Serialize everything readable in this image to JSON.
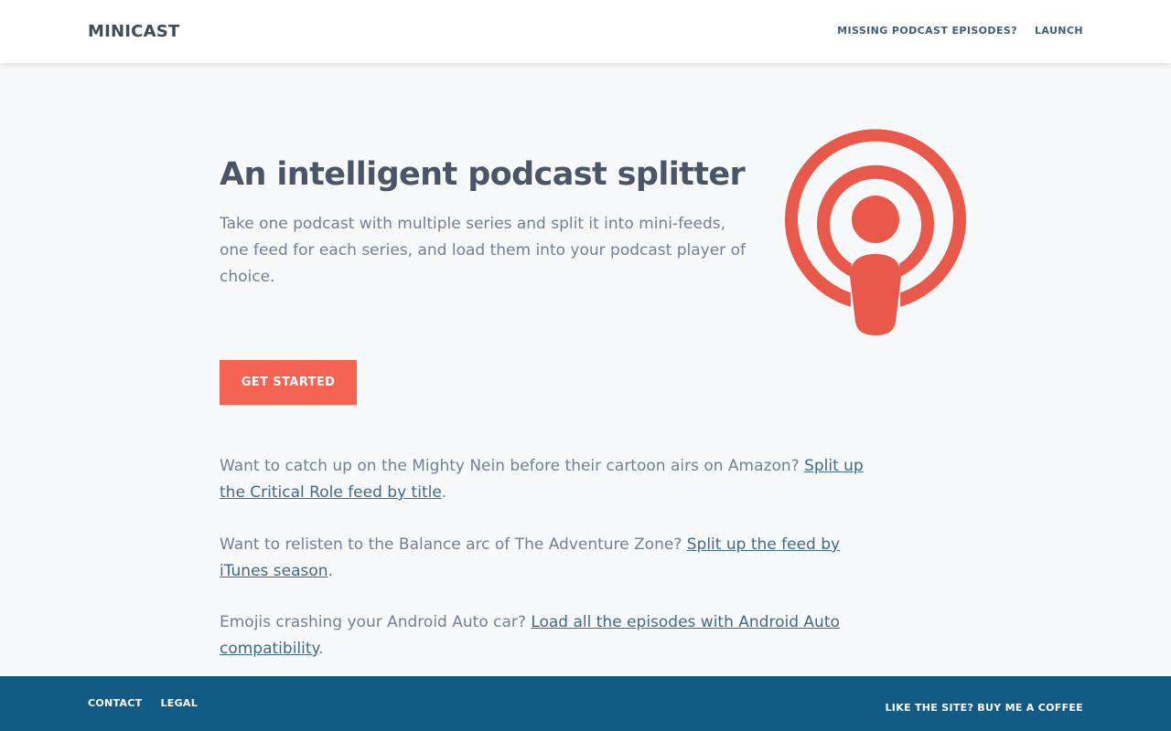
{
  "header": {
    "brand": "MINICAST",
    "nav": [
      {
        "label": "MISSING PODCAST EPISODES?"
      },
      {
        "label": "LAUNCH"
      }
    ]
  },
  "hero": {
    "title": "An intelligent podcast splitter",
    "subtitle": "Take one podcast with multiple series and split it into mini-feeds, one feed for each series, and load them into your podcast player of choice.",
    "cta_label": "GET STARTED",
    "logo_icon": "podcast-icon"
  },
  "examples": [
    {
      "text": "Want to catch up on the Mighty Nein before their cartoon airs on Amazon? ",
      "link": "Split up the Critical Role feed by title",
      "after": "."
    },
    {
      "text": "Want to relisten to the Balance arc of The Adventure Zone? ",
      "link": "Split up the feed by iTunes season",
      "after": "."
    },
    {
      "text": "Emojis crashing your Android Auto car? ",
      "link": "Load all the episodes with Android Auto compatibility",
      "after": "."
    }
  ],
  "footer": {
    "left": [
      {
        "label": "CONTACT"
      },
      {
        "label": "LEGAL"
      }
    ],
    "right": {
      "label": "LIKE THE SITE? BUY ME A COFFEE"
    }
  },
  "colors": {
    "accent": "#f56452",
    "logo": "#e8594a",
    "footer_bg": "#125b84",
    "link": "#3f6a8a"
  }
}
